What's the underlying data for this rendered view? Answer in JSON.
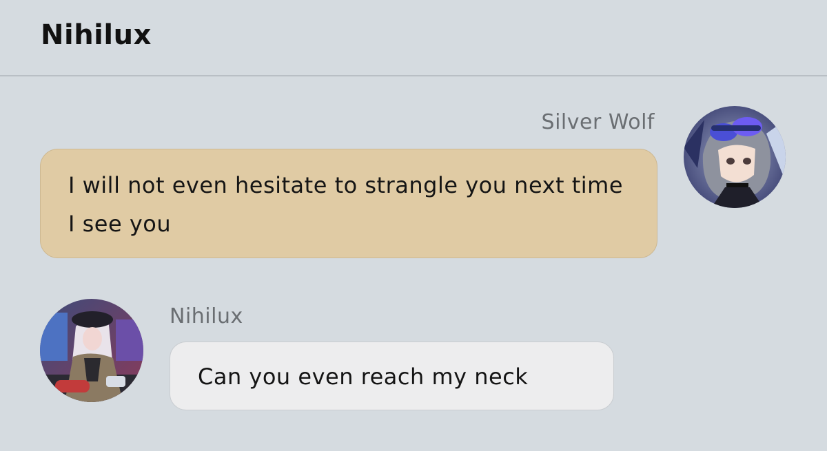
{
  "header": {
    "title": "Nihilux"
  },
  "messages": [
    {
      "sender": "Silver Wolf",
      "side": "right",
      "text": "I will not even hesitate to strangle you next time I see you",
      "avatar": "silver-wolf-avatar",
      "bubble_color": "#e0cba4"
    },
    {
      "sender": "Nihilux",
      "side": "left",
      "text": "Can you even reach my neck",
      "avatar": "nihilux-avatar",
      "bubble_color": "#ededee"
    }
  ],
  "colors": {
    "background": "#d5dbe0",
    "name_text": "#6a6e72",
    "divider": "#b9bfc5"
  }
}
